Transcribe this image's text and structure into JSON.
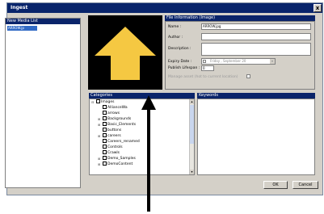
{
  "window": {
    "title": "Ingest",
    "close_label": "x"
  },
  "media_list": {
    "header": "New Media List",
    "items": [
      "ARROW.jp"
    ]
  },
  "file_info": {
    "header": "File Information (Image)",
    "name_label": "Name :",
    "name_value": "ARROW.jpg",
    "author_label": "Author :",
    "description_label": "Description :",
    "expiry_label": "Expiry Date :",
    "expiry_value": "Friday , September 20",
    "publish_label": "Publish Lifespan :",
    "publish_value": "0",
    "current_location_label": "Manage asset (hot to current location)"
  },
  "categories": {
    "header": "Categories",
    "items": [
      {
        "label": "Images",
        "expander": "□"
      },
      {
        "label": "AllianceWa",
        "expander": ""
      },
      {
        "label": "arrows",
        "expander": ""
      },
      {
        "label": "Backgrounds",
        "expander": "+"
      },
      {
        "label": "Basic_Elements",
        "expander": "+"
      },
      {
        "label": "buttons",
        "expander": ""
      },
      {
        "label": "careers",
        "expander": "+"
      },
      {
        "label": "Careers_renamed",
        "expander": ""
      },
      {
        "label": "Controls",
        "expander": ""
      },
      {
        "label": "Crawls",
        "expander": ""
      },
      {
        "label": "Demo_Samples",
        "expander": "+"
      },
      {
        "label": "DemoContent",
        "expander": "+"
      }
    ]
  },
  "keywords": {
    "header": "Keywords"
  },
  "buttons": {
    "ok": "OK",
    "cancel": "Cancel"
  },
  "colors": {
    "title_bar": "#08246b",
    "preview_arrow": "#f5c842",
    "window_bg": "#d4d0c8"
  }
}
